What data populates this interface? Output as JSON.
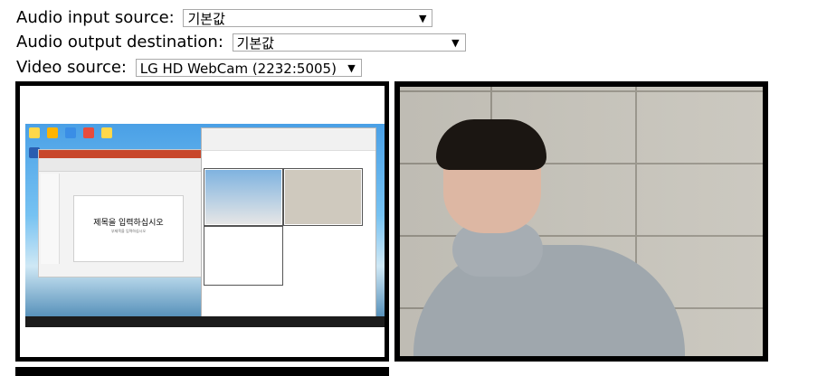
{
  "controls": {
    "audio_input": {
      "label": "Audio input source:",
      "value": "기본값"
    },
    "audio_output": {
      "label": "Audio output destination:",
      "value": "기본값"
    },
    "video_source": {
      "label": "Video source:",
      "value": "LG HD WebCam (2232:5005)"
    }
  },
  "local_preview": {
    "slide_title": "제목을 입력하십시오",
    "slide_subtitle": "부제목을 입력하십시오"
  },
  "icons": {
    "caret": "▼"
  }
}
